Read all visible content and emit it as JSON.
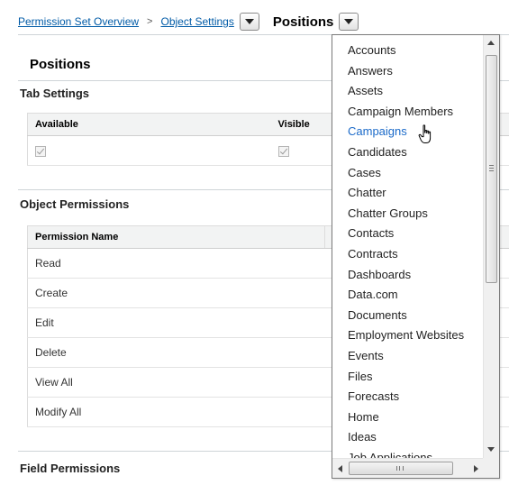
{
  "breadcrumb": {
    "overview_link": "Permission Set Overview",
    "separator": ">",
    "object_settings_link": "Object Settings",
    "current": "Positions"
  },
  "page_title": "Positions",
  "tab_settings": {
    "heading": "Tab Settings",
    "columns": [
      "Available",
      "Visible"
    ],
    "available_checked": true,
    "visible_checked": true
  },
  "object_permissions": {
    "heading": "Object Permissions",
    "column": "Permission Name",
    "rows": [
      "Read",
      "Create",
      "Edit",
      "Delete",
      "View All",
      "Modify All"
    ]
  },
  "field_permissions": {
    "heading": "Field Permissions"
  },
  "object_dropdown": {
    "items": [
      "Accounts",
      "Answers",
      "Assets",
      "Campaign Members",
      "Campaigns",
      "Candidates",
      "Cases",
      "Chatter",
      "Chatter Groups",
      "Contacts",
      "Contracts",
      "Dashboards",
      "Data.com",
      "Documents",
      "Employment Websites",
      "Events",
      "Files",
      "Forecasts",
      "Home",
      "Ideas",
      "Job Applications"
    ],
    "hovered": "Campaigns"
  },
  "colors": {
    "link": "#015ba7",
    "hover_item": "#1b6ac9",
    "table_header_bg": "#f2f3f3"
  }
}
